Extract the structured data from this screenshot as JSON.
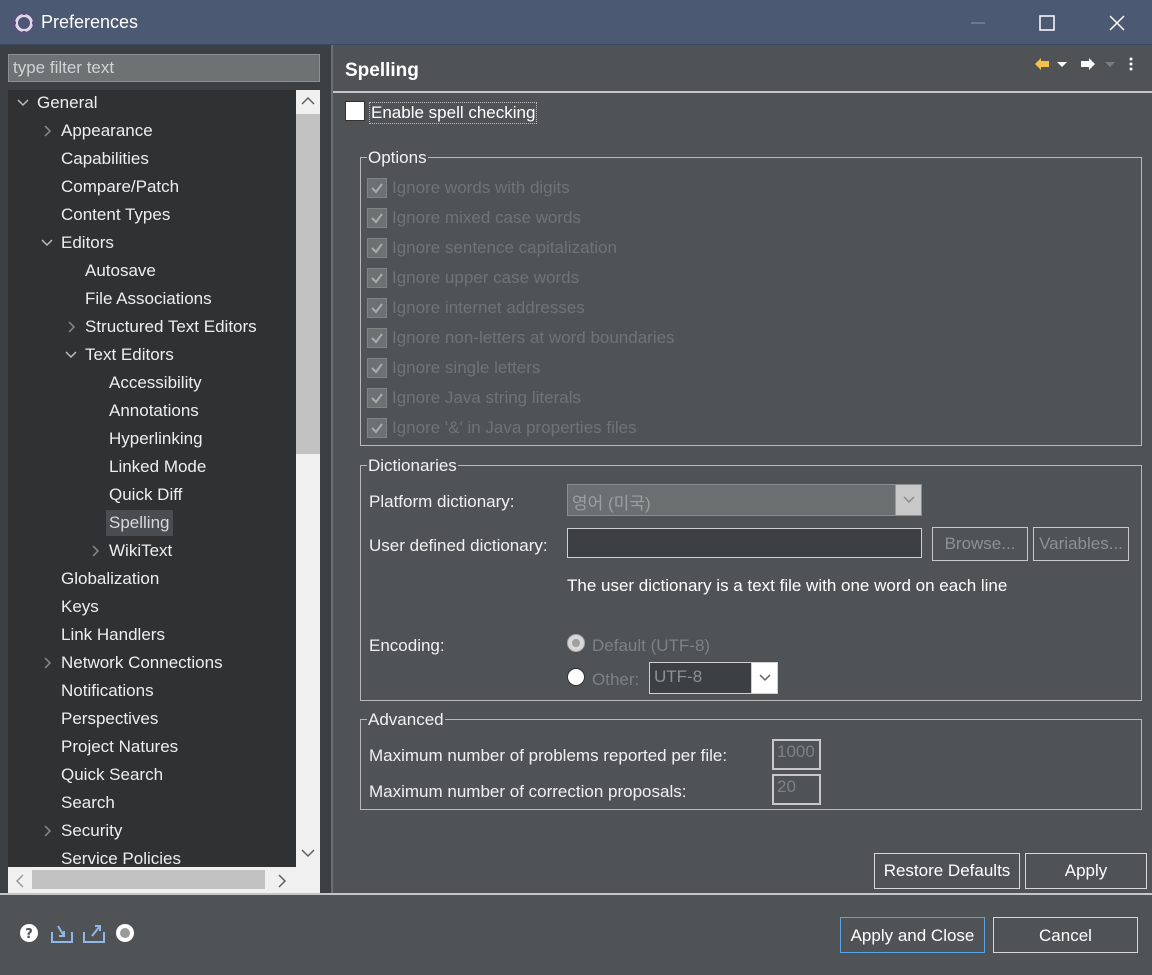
{
  "window": {
    "title": "Preferences"
  },
  "filter": {
    "placeholder": "type filter text"
  },
  "tree": {
    "items": [
      {
        "label": "General"
      },
      {
        "label": "Appearance"
      },
      {
        "label": "Capabilities"
      },
      {
        "label": "Compare/Patch"
      },
      {
        "label": "Content Types"
      },
      {
        "label": "Editors"
      },
      {
        "label": "Autosave"
      },
      {
        "label": "File Associations"
      },
      {
        "label": "Structured Text Editors"
      },
      {
        "label": "Text Editors"
      },
      {
        "label": "Accessibility"
      },
      {
        "label": "Annotations"
      },
      {
        "label": "Hyperlinking"
      },
      {
        "label": "Linked Mode"
      },
      {
        "label": "Quick Diff"
      },
      {
        "label": "Spelling"
      },
      {
        "label": "WikiText"
      },
      {
        "label": "Globalization"
      },
      {
        "label": "Keys"
      },
      {
        "label": "Link Handlers"
      },
      {
        "label": "Network Connections"
      },
      {
        "label": "Notifications"
      },
      {
        "label": "Perspectives"
      },
      {
        "label": "Project Natures"
      },
      {
        "label": "Quick Search"
      },
      {
        "label": "Search"
      },
      {
        "label": "Security"
      },
      {
        "label": "Service Policies"
      }
    ]
  },
  "page": {
    "title": "Spelling",
    "enable_label": "Enable spell checking",
    "options": {
      "title": "Options",
      "items": [
        "Ignore words with digits",
        "Ignore mixed case words",
        "Ignore sentence capitalization",
        "Ignore upper case words",
        "Ignore internet addresses",
        "Ignore non-letters at word boundaries",
        "Ignore single letters",
        "Ignore Java string literals",
        "Ignore '&' in Java properties files"
      ]
    },
    "dictionaries": {
      "title": "Dictionaries",
      "platform_label": "Platform dictionary:",
      "platform_value": "영어 (미국)",
      "user_label": "User defined dictionary:",
      "user_value": "",
      "browse": "Browse...",
      "variables": "Variables...",
      "hint": "The user dictionary is a text file with one word on each line",
      "encoding_label": "Encoding:",
      "default_encoding": "Default (UTF-8)",
      "other_label": "Other:",
      "other_value": "UTF-8"
    },
    "advanced": {
      "title": "Advanced",
      "max_problems_label": "Maximum number of problems reported per file:",
      "max_problems_value": "1000",
      "max_proposals_label": "Maximum number of correction proposals:",
      "max_proposals_value": "20"
    },
    "restore_defaults": "Restore Defaults",
    "apply": "Apply"
  },
  "footer": {
    "apply_and_close": "Apply and Close",
    "cancel": "Cancel"
  },
  "colors": {
    "title_bar": "#4b5a72",
    "background": "#4f5355",
    "tree_background": "#2f3133",
    "default_button_border": "#5aa2e6"
  }
}
